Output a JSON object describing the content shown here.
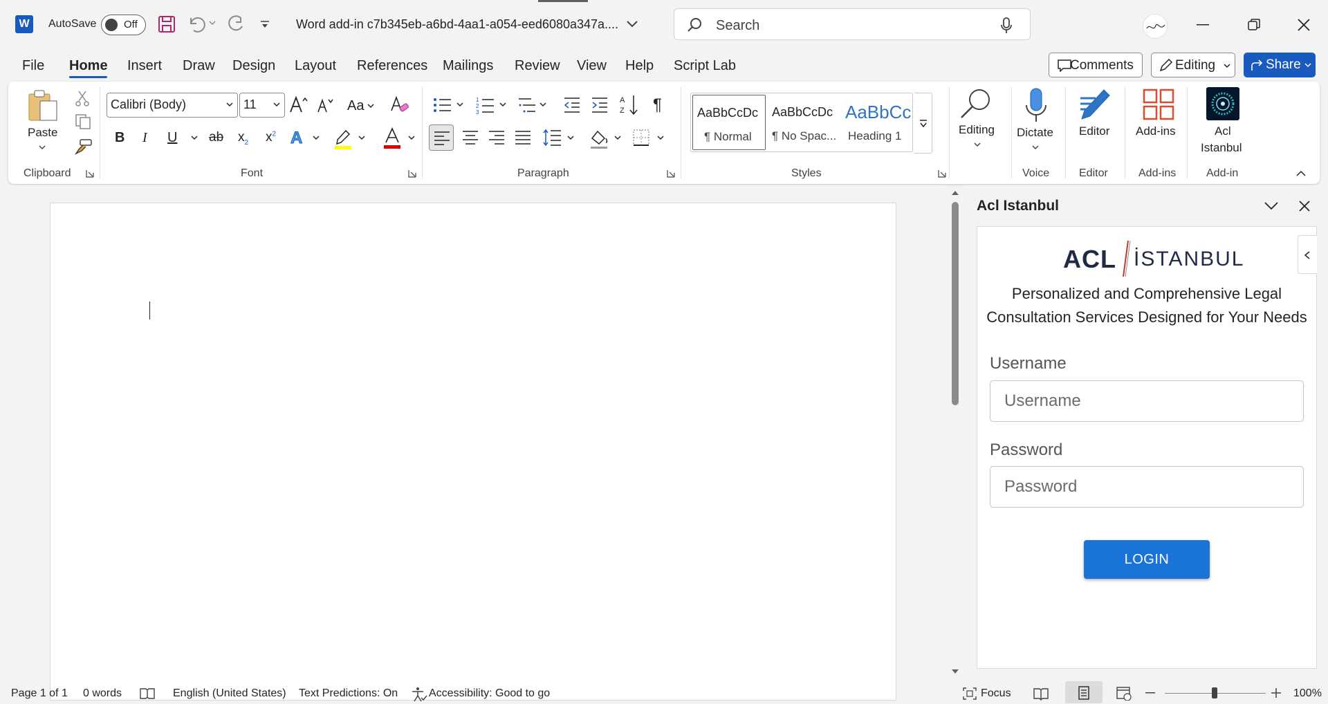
{
  "titlebar": {
    "autosave_label": "AutoSave",
    "autosave_state": "Off",
    "doc_title": "Word add-in c7b345eb-a6bd-4aa1-a054-eed6080a347a....",
    "search_placeholder": "Search"
  },
  "menu": {
    "items": [
      "File",
      "Home",
      "Insert",
      "Draw",
      "Design",
      "Layout",
      "References",
      "Mailings",
      "Review",
      "View",
      "Help",
      "Script Lab"
    ],
    "active": "Home",
    "comments_label": "Comments",
    "editing_label": "Editing",
    "share_label": "Share"
  },
  "ribbon": {
    "clipboard": {
      "paste": "Paste",
      "group": "Clipboard"
    },
    "font": {
      "name": "Calibri (Body)",
      "size": "11",
      "case_label": "Aa",
      "group": "Font",
      "highlight_color": "#ffff00",
      "font_color": "#e00000"
    },
    "paragraph": {
      "group": "Paragraph"
    },
    "styles": {
      "group": "Styles",
      "items": [
        {
          "preview": "AaBbCcDc",
          "name": "¶ Normal"
        },
        {
          "preview": "AaBbCcDc",
          "name": "¶ No Spac..."
        },
        {
          "preview": "AaBbCc",
          "name": "Heading 1"
        }
      ]
    },
    "editing": {
      "label": "Editing"
    },
    "voice": {
      "label": "Dictate",
      "group": "Voice"
    },
    "editor": {
      "label": "Editor",
      "group": "Editor"
    },
    "addins": {
      "label": "Add-ins",
      "group": "Add-ins"
    },
    "addin": {
      "label_line1": "Acl",
      "label_line2": "Istanbul",
      "group": "Add-in"
    }
  },
  "pane": {
    "title": "Acl Istanbul",
    "logo_text": "ACL",
    "logo_text2": "İSTANBUL",
    "tagline_line1": "Personalized and Comprehensive Legal",
    "tagline_line2": "Consultation Services Designed for Your Needs",
    "username_label": "Username",
    "username_placeholder": "Username",
    "password_label": "Password",
    "password_placeholder": "Password",
    "login_label": "LOGIN",
    "brand_color": "#1a73d8"
  },
  "status": {
    "page": "Page 1 of 1",
    "words": "0 words",
    "language": "English (United States)",
    "predictions": "Text Predictions: On",
    "accessibility": "Accessibility: Good to go",
    "focus": "Focus",
    "zoom": "100%"
  }
}
